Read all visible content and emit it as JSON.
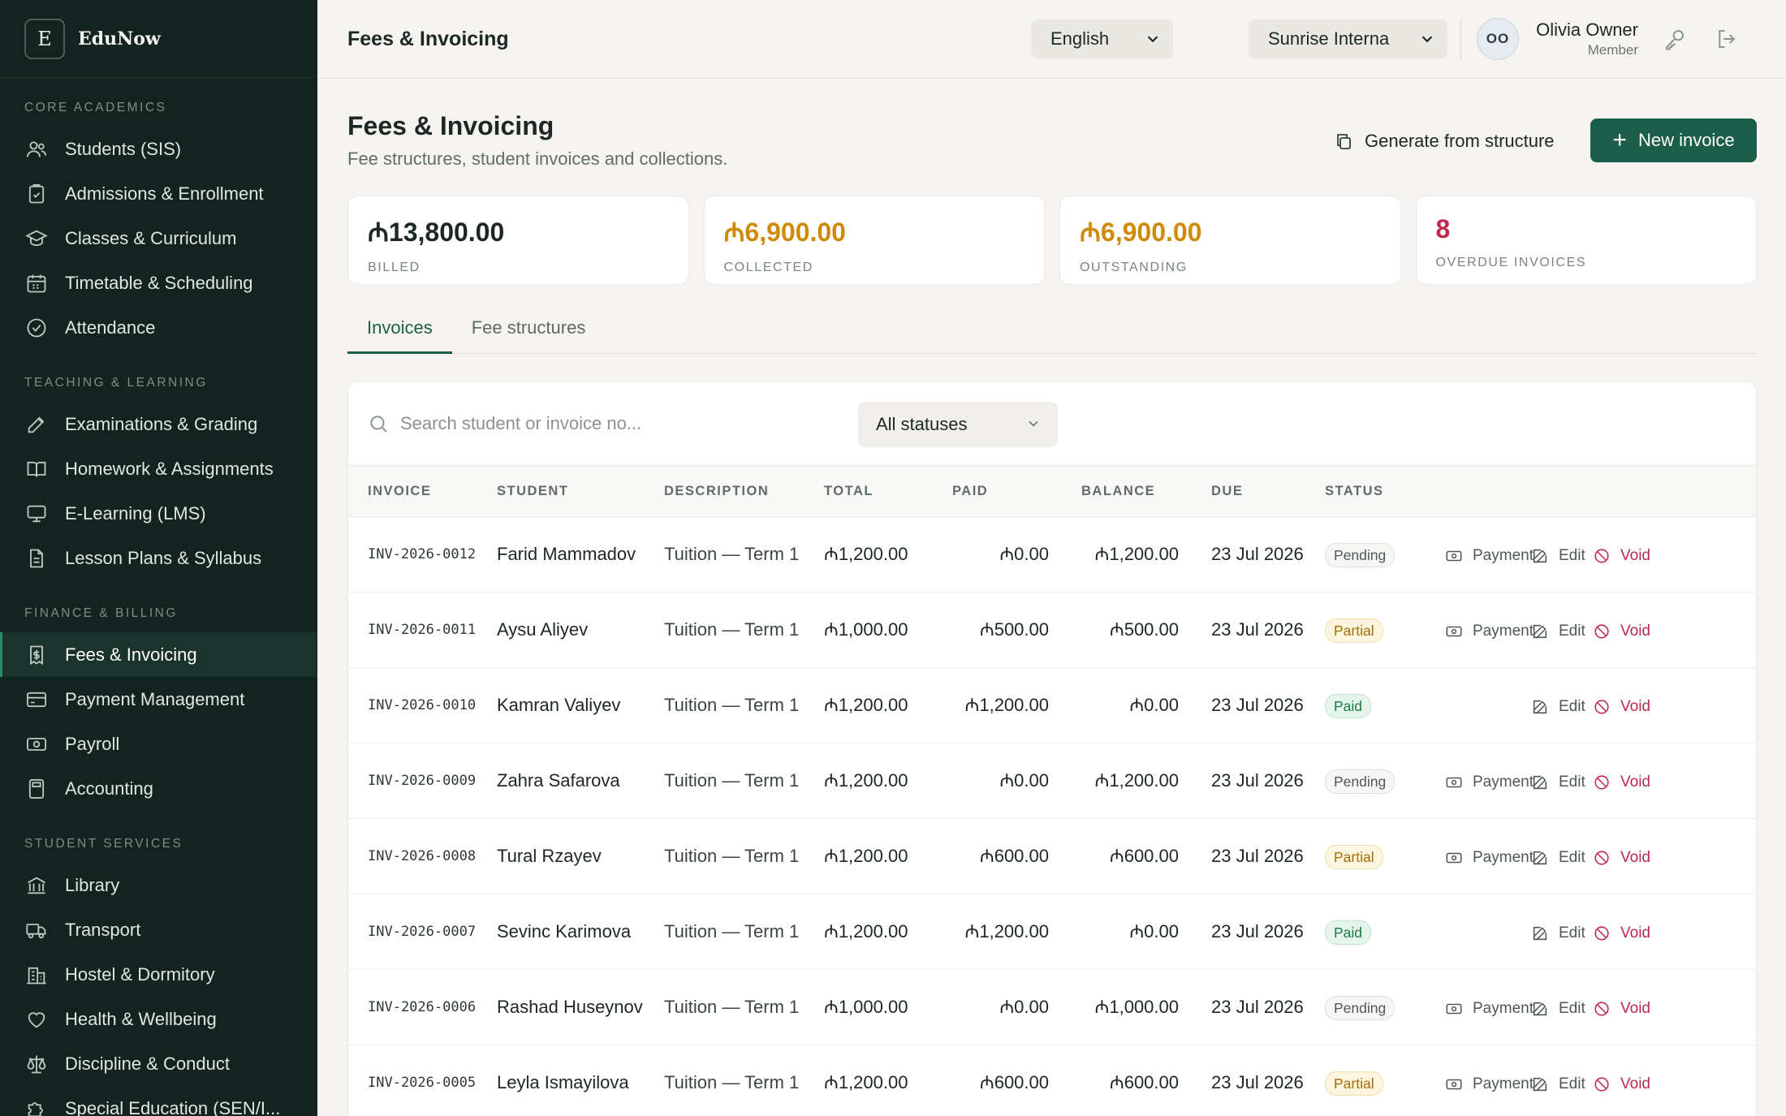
{
  "brand": {
    "logo_letter": "E",
    "name": "EduNow"
  },
  "sidebar": {
    "groups": [
      {
        "title": "Core Academics",
        "items": [
          {
            "label": "Students (SIS)",
            "icon": "users-icon"
          },
          {
            "label": "Admissions & Enrollment",
            "icon": "clipboard-check-icon"
          },
          {
            "label": "Classes & Curriculum",
            "icon": "graduation-cap-icon"
          },
          {
            "label": "Timetable & Scheduling",
            "icon": "calendar-icon"
          },
          {
            "label": "Attendance",
            "icon": "check-circle-icon"
          }
        ]
      },
      {
        "title": "Teaching & Learning",
        "items": [
          {
            "label": "Examinations & Grading",
            "icon": "edit-icon"
          },
          {
            "label": "Homework & Assignments",
            "icon": "book-open-icon"
          },
          {
            "label": "E-Learning (LMS)",
            "icon": "monitor-icon"
          },
          {
            "label": "Lesson Plans & Syllabus",
            "icon": "document-icon"
          }
        ]
      },
      {
        "title": "Finance & Billing",
        "items": [
          {
            "label": "Fees & Invoicing",
            "icon": "receipt-icon",
            "active": true
          },
          {
            "label": "Payment Management",
            "icon": "credit-card-icon"
          },
          {
            "label": "Payroll",
            "icon": "banknote-icon"
          },
          {
            "label": "Accounting",
            "icon": "calculator-icon"
          }
        ]
      },
      {
        "title": "Student Services",
        "items": [
          {
            "label": "Library",
            "icon": "library-icon"
          },
          {
            "label": "Transport",
            "icon": "truck-icon"
          },
          {
            "label": "Hostel & Dormitory",
            "icon": "building-icon"
          },
          {
            "label": "Health & Wellbeing",
            "icon": "heart-icon"
          },
          {
            "label": "Discipline & Conduct",
            "icon": "scale-icon"
          },
          {
            "label": "Special Education (SEN/I...",
            "icon": "puzzle-icon"
          }
        ]
      }
    ]
  },
  "topbar": {
    "title": "Fees & Invoicing",
    "language": "English",
    "school": "Sunrise Interna",
    "user": {
      "initials": "OO",
      "name": "Olivia Owner",
      "role": "Member"
    }
  },
  "page": {
    "title": "Fees & Invoicing",
    "subtitle": "Fee structures, student invoices and collections.",
    "generate_label": "Generate from structure",
    "new_invoice_label": "New invoice"
  },
  "stats": [
    {
      "value": "₼13,800.00",
      "label": "Billed",
      "color": "#1d2724"
    },
    {
      "value": "₼6,900.00",
      "label": "Collected",
      "color": "#cf8a08"
    },
    {
      "value": "₼6,900.00",
      "label": "Outstanding",
      "color": "#cf8a08"
    },
    {
      "value": "8",
      "label": "Overdue invoices",
      "color": "#c0284e"
    }
  ],
  "tabs": [
    {
      "label": "Invoices",
      "active": true
    },
    {
      "label": "Fee structures",
      "active": false
    }
  ],
  "filters": {
    "search_placeholder": "Search student or invoice no...",
    "status": "All statuses"
  },
  "table": {
    "headers": {
      "invoice": "Invoice",
      "student": "Student",
      "description": "Description",
      "total": "Total",
      "paid": "Paid",
      "balance": "Balance",
      "due": "Due",
      "status": "Status"
    },
    "actions": {
      "payment": "Payment",
      "edit": "Edit",
      "void": "Void"
    },
    "rows": [
      {
        "invoice": "INV-2026-0012",
        "student": "Farid Mammadov",
        "description": "Tuition — Term 1",
        "total": "₼1,200.00",
        "paid": "₼0.00",
        "balance": "₼1,200.00",
        "due": "23 Jul 2026",
        "status": "Pending"
      },
      {
        "invoice": "INV-2026-0011",
        "student": "Aysu Aliyev",
        "description": "Tuition — Term 1",
        "total": "₼1,000.00",
        "paid": "₼500.00",
        "balance": "₼500.00",
        "due": "23 Jul 2026",
        "status": "Partial"
      },
      {
        "invoice": "INV-2026-0010",
        "student": "Kamran Valiyev",
        "description": "Tuition — Term 1",
        "total": "₼1,200.00",
        "paid": "₼1,200.00",
        "balance": "₼0.00",
        "due": "23 Jul 2026",
        "status": "Paid"
      },
      {
        "invoice": "INV-2026-0009",
        "student": "Zahra Safarova",
        "description": "Tuition — Term 1",
        "total": "₼1,200.00",
        "paid": "₼0.00",
        "balance": "₼1,200.00",
        "due": "23 Jul 2026",
        "status": "Pending"
      },
      {
        "invoice": "INV-2026-0008",
        "student": "Tural Rzayev",
        "description": "Tuition — Term 1",
        "total": "₼1,200.00",
        "paid": "₼600.00",
        "balance": "₼600.00",
        "due": "23 Jul 2026",
        "status": "Partial"
      },
      {
        "invoice": "INV-2026-0007",
        "student": "Sevinc Karimova",
        "description": "Tuition — Term 1",
        "total": "₼1,200.00",
        "paid": "₼1,200.00",
        "balance": "₼0.00",
        "due": "23 Jul 2026",
        "status": "Paid"
      },
      {
        "invoice": "INV-2026-0006",
        "student": "Rashad Huseynov",
        "description": "Tuition — Term 1",
        "total": "₼1,000.00",
        "paid": "₼0.00",
        "balance": "₼1,000.00",
        "due": "23 Jul 2026",
        "status": "Pending"
      },
      {
        "invoice": "INV-2026-0005",
        "student": "Leyla Ismayilova",
        "description": "Tuition — Term 1",
        "total": "₼1,200.00",
        "paid": "₼600.00",
        "balance": "₼600.00",
        "due": "23 Jul 2026",
        "status": "Partial"
      }
    ]
  }
}
